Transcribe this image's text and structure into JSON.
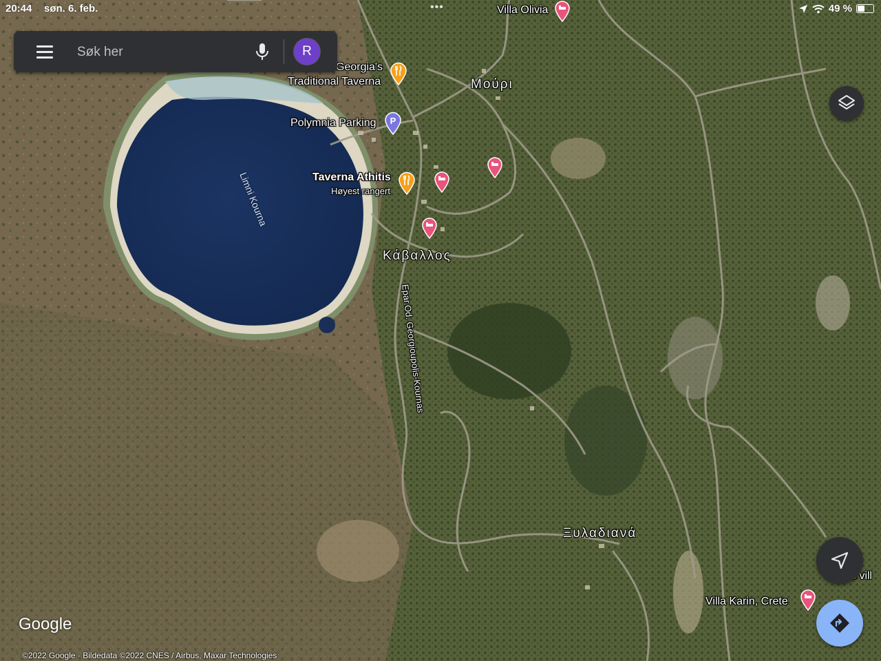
{
  "status_bar": {
    "time": "20:44",
    "date": "søn. 6. feb.",
    "battery": "49 %",
    "battery_level": 0.49
  },
  "search": {
    "placeholder": "Søk her",
    "avatar_initial": "R"
  },
  "colors": {
    "restaurant_pin": "#f6a019",
    "hotel_pin": "#e8547c",
    "parking_pin": "#7b77e0",
    "directions_button": "#8ab4f8",
    "avatar": "#6e3fc9"
  },
  "map": {
    "lake_name": "Limni Kourna",
    "road_name": "Epar.Od. Georgioupolis-Kournas",
    "places": {
      "mouri": "Μούρι",
      "kavallos": "Κάβαλλος",
      "xyladiana": "Ξυλαδιανά"
    },
    "pois": {
      "villa_olivia": "Villa Olivia",
      "georgias_line1": "Georgia's",
      "georgias_line2": "Traditional Taverna",
      "polymnia_parking": "Polymnia Parking",
      "taverna_athitis": "Taverna Athitis",
      "taverna_athitis_sub": "Høyest rangert",
      "villa_karin": "Villa Karin, Crete",
      "villa_partial": "s vill"
    }
  },
  "footer": {
    "logo": "Google",
    "attribution": "©2022 Google · Bildedata ©2022 CNES / Airbus, Maxar Technologies"
  }
}
